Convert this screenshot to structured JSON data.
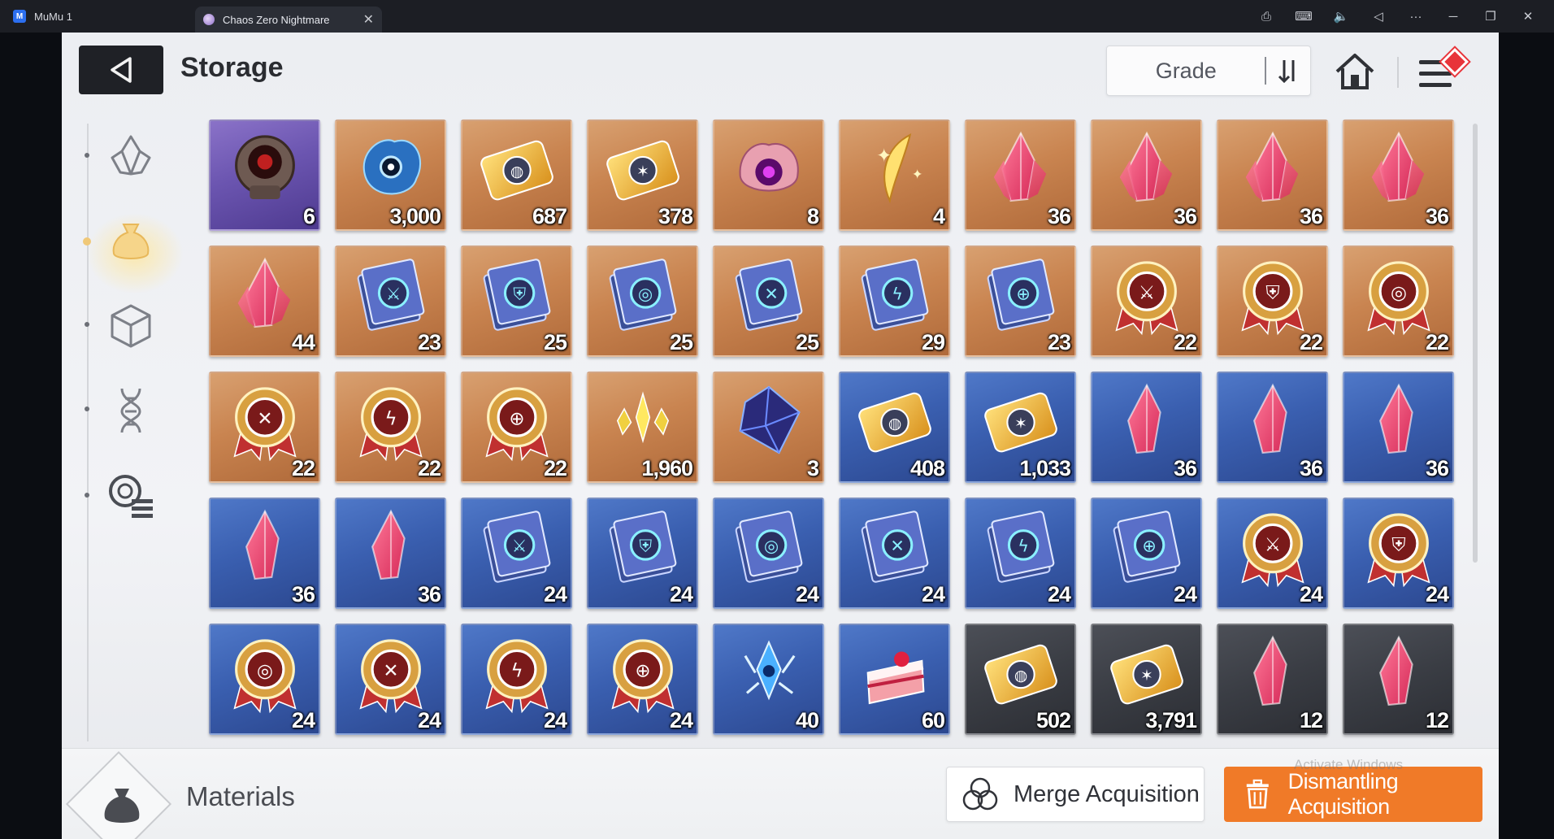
{
  "window": {
    "app_name": "MuMu 1",
    "tab_title": "Chaos Zero Nightmare",
    "tab_close": "✕",
    "actions": [
      {
        "name": "record-icon",
        "glyph": "⎙"
      },
      {
        "name": "keyboard-icon",
        "glyph": "⌨"
      },
      {
        "name": "volume-mute-icon",
        "glyph": "🔈"
      },
      {
        "name": "back-nav-icon",
        "glyph": "◁"
      },
      {
        "name": "more-icon",
        "glyph": "···"
      },
      {
        "name": "minimize-icon",
        "glyph": "─"
      },
      {
        "name": "restore-icon",
        "glyph": "❐"
      },
      {
        "name": "close-window-icon",
        "glyph": "✕"
      }
    ]
  },
  "header": {
    "title": "Storage",
    "sort_label": "Grade",
    "sort_dir_glyph": "↓↑"
  },
  "categories": [
    {
      "name": "crystal-category-icon",
      "active": false
    },
    {
      "name": "materials-category-icon",
      "active": true
    },
    {
      "name": "cube-category-icon",
      "active": false
    },
    {
      "name": "dna-category-icon",
      "active": false
    },
    {
      "name": "search-list-category-icon",
      "active": false
    }
  ],
  "items": [
    {
      "icon": "dark-skull",
      "bg": "purple",
      "qty": "6"
    },
    {
      "icon": "blue-eye-creature",
      "bg": "orange",
      "qty": "3,000"
    },
    {
      "icon": "gold-profile-ticket",
      "bg": "orange",
      "qty": "687"
    },
    {
      "icon": "gold-star-ticket",
      "bg": "orange",
      "qty": "378"
    },
    {
      "icon": "pink-brain-eye",
      "bg": "orange",
      "qty": "8"
    },
    {
      "icon": "gold-feather",
      "bg": "orange",
      "qty": "4"
    },
    {
      "icon": "red-crystal",
      "bg": "orange",
      "qty": "36"
    },
    {
      "icon": "orange-crystal",
      "bg": "orange",
      "qty": "36"
    },
    {
      "icon": "purple-crystal",
      "bg": "orange",
      "qty": "36"
    },
    {
      "icon": "green-crystal",
      "bg": "orange",
      "qty": "36"
    },
    {
      "icon": "blue-crystal",
      "bg": "orange",
      "qty": "44"
    },
    {
      "icon": "sword-book",
      "bg": "orange",
      "qty": "23"
    },
    {
      "icon": "shield-book",
      "bg": "orange",
      "qty": "25"
    },
    {
      "icon": "target-book",
      "bg": "orange",
      "qty": "25"
    },
    {
      "icon": "wing-book",
      "bg": "orange",
      "qty": "25"
    },
    {
      "icon": "lightning-book",
      "bg": "orange",
      "qty": "29"
    },
    {
      "icon": "orb-book",
      "bg": "orange",
      "qty": "23"
    },
    {
      "icon": "sword-medal",
      "bg": "orange",
      "qty": "22"
    },
    {
      "icon": "shield-medal",
      "bg": "orange",
      "qty": "22"
    },
    {
      "icon": "target-medal",
      "bg": "orange",
      "qty": "22"
    },
    {
      "icon": "wing-medal",
      "bg": "orange",
      "qty": "22"
    },
    {
      "icon": "lightning-medal",
      "bg": "orange",
      "qty": "22"
    },
    {
      "icon": "orb-medal",
      "bg": "orange",
      "qty": "22"
    },
    {
      "icon": "gold-shards",
      "bg": "orange",
      "qty": "1,960"
    },
    {
      "icon": "dark-gem-cube",
      "bg": "orange",
      "qty": "3"
    },
    {
      "icon": "blue-profile-ticket",
      "bg": "blue",
      "qty": "408"
    },
    {
      "icon": "blue-star-ticket",
      "bg": "blue",
      "qty": "1,033"
    },
    {
      "icon": "red-shard",
      "bg": "blue",
      "qty": "36"
    },
    {
      "icon": "orange-shard",
      "bg": "blue",
      "qty": "36"
    },
    {
      "icon": "purple-shard",
      "bg": "blue",
      "qty": "36"
    },
    {
      "icon": "green-shard",
      "bg": "blue",
      "qty": "36"
    },
    {
      "icon": "blue-shard",
      "bg": "blue",
      "qty": "36"
    },
    {
      "icon": "sword-book",
      "bg": "blue",
      "qty": "24"
    },
    {
      "icon": "shield-book",
      "bg": "blue",
      "qty": "24"
    },
    {
      "icon": "target-book",
      "bg": "blue",
      "qty": "24"
    },
    {
      "icon": "wing-book",
      "bg": "blue",
      "qty": "24"
    },
    {
      "icon": "lightning-book",
      "bg": "blue",
      "qty": "24"
    },
    {
      "icon": "orb-book",
      "bg": "blue",
      "qty": "24"
    },
    {
      "icon": "sword-medal",
      "bg": "blue",
      "qty": "24"
    },
    {
      "icon": "shield-medal",
      "bg": "blue",
      "qty": "24"
    },
    {
      "icon": "target-medal",
      "bg": "blue",
      "qty": "24"
    },
    {
      "icon": "wing-medal",
      "bg": "blue",
      "qty": "24"
    },
    {
      "icon": "lightning-medal",
      "bg": "blue",
      "qty": "24"
    },
    {
      "icon": "orb-medal",
      "bg": "blue",
      "qty": "24"
    },
    {
      "icon": "ice-gem",
      "bg": "blue",
      "qty": "40"
    },
    {
      "icon": "strawberry-cake",
      "bg": "blue",
      "qty": "60"
    },
    {
      "icon": "silver-profile-ticket",
      "bg": "gray",
      "qty": "502"
    },
    {
      "icon": "silver-star-ticket",
      "bg": "gray",
      "qty": "3,791"
    },
    {
      "icon": "red-shard",
      "bg": "gray",
      "qty": "12"
    },
    {
      "icon": "orange-shard",
      "bg": "gray",
      "qty": "12"
    }
  ],
  "bottom": {
    "category_label": "Materials",
    "merge_label": "Merge Acquisition",
    "dismantle_label": "Dismantling Acquisition",
    "watermark": "Activate Windows"
  },
  "colors": {
    "accent": "#f07a28",
    "badge": "#e8343a",
    "orange_slot": "#c98450",
    "blue_slot": "#3a5fb0",
    "purple_slot": "#6b55b0",
    "gray_slot": "#3a3d44"
  }
}
